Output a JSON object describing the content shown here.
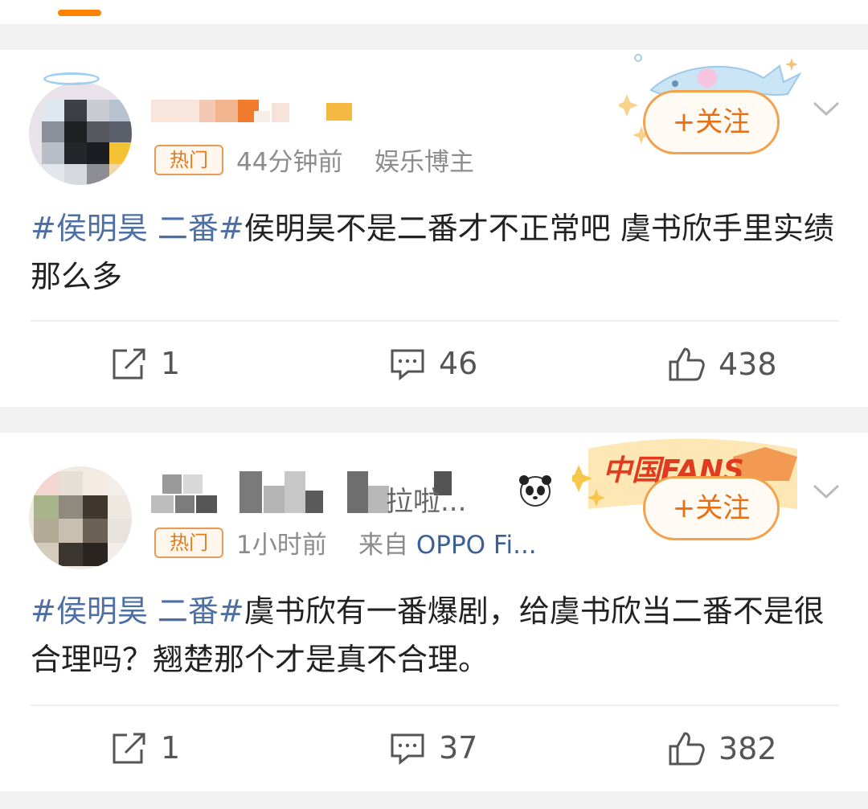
{
  "posts": [
    {
      "badge": "热门",
      "time": "44分钟前",
      "source": "娱乐博主",
      "follow": "+关注",
      "hashtag": "#侯明昊 二番#",
      "body": "侯明昊不是二番才不正常吧 虞书欣手里实绩那么多",
      "reposts": "1",
      "comments": "46",
      "likes": "438"
    },
    {
      "name_tail": "拉啦...",
      "badge": "热门",
      "time": "1小时前",
      "source_prefix": "来自",
      "source": "OPPO Fi...",
      "follow": "+关注",
      "hashtag": "#侯明昊 二番#",
      "body": "虞书欣有一番爆剧，给虞书欣当二番不是很合理吗？翘楚那个才是真不合理。",
      "reposts": "1",
      "comments": "37",
      "likes": "382",
      "decoration_text": "中国FANS"
    }
  ],
  "icons": {
    "repost": "repost-icon",
    "comment": "comment-icon",
    "like": "like-icon",
    "more": "chevron-down-icon",
    "panda": "panda-icon"
  },
  "colors": {
    "accent_orange": "#ff8200",
    "link_blue": "#4e6fa4",
    "meta_gray": "#8c8c8c"
  }
}
